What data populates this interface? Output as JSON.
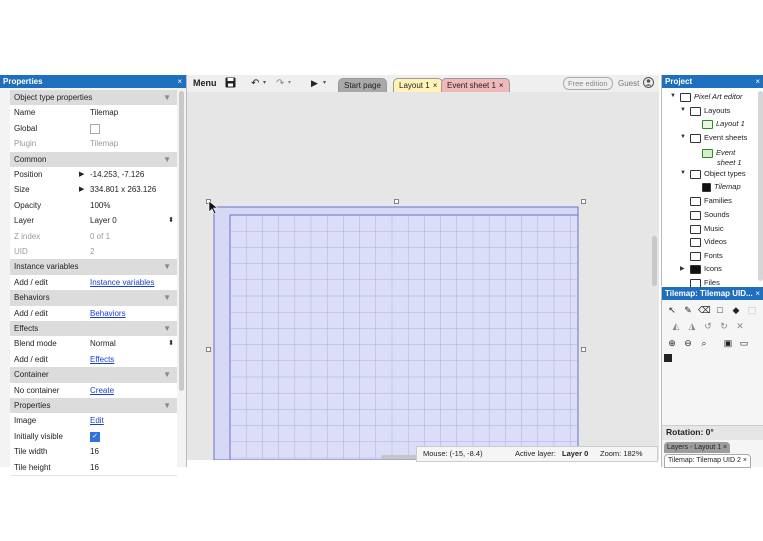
{
  "properties_panel": {
    "title": "Properties",
    "close": "×",
    "rows": [
      {
        "type": "section",
        "label": "Object type properties"
      },
      {
        "label": "Name",
        "value": "Tilemap"
      },
      {
        "label": "Global",
        "value": "",
        "kind": "checkbox",
        "checked": false
      },
      {
        "label": "Plugin",
        "value": "Tilemap",
        "disabled": true
      },
      {
        "type": "section",
        "label": "Common"
      },
      {
        "label": "Position",
        "value": "-14.253, -7.126",
        "expand": true
      },
      {
        "label": "Size",
        "value": "334.801 x 263.126",
        "expand": true
      },
      {
        "label": "Opacity",
        "value": "100%"
      },
      {
        "label": "Layer",
        "value": "Layer 0",
        "kind": "select"
      },
      {
        "label": "Z index",
        "value": "0 of 1",
        "disabled": true
      },
      {
        "label": "UID",
        "value": "2",
        "disabled": true
      },
      {
        "type": "section",
        "label": "Instance variables"
      },
      {
        "label": "Add / edit",
        "value": "Instance variables",
        "kind": "link"
      },
      {
        "type": "section",
        "label": "Behaviors"
      },
      {
        "label": "Add / edit",
        "value": "Behaviors",
        "kind": "link"
      },
      {
        "type": "section",
        "label": "Effects"
      },
      {
        "label": "Blend mode",
        "value": "Normal",
        "kind": "select"
      },
      {
        "label": "Add / edit",
        "value": "Effects",
        "kind": "link"
      },
      {
        "type": "section",
        "label": "Container"
      },
      {
        "label": "No container",
        "value": "Create",
        "kind": "link"
      },
      {
        "type": "section",
        "label": "Properties"
      },
      {
        "label": "Image",
        "value": "Edit",
        "kind": "link"
      },
      {
        "label": "Initially visible",
        "value": "",
        "kind": "checkbox",
        "checked": true
      },
      {
        "label": "Tile width",
        "value": "16"
      },
      {
        "label": "Tile height",
        "value": "16"
      }
    ]
  },
  "toolbar": {
    "menu_label": "Menu",
    "free_edition": "Free edition",
    "guest": "Guest"
  },
  "tabs": [
    {
      "label": "Start page",
      "bg": "#a9a9a9",
      "close": ""
    },
    {
      "label": "Layout 1",
      "bg": "#fff3b8",
      "close": "×"
    },
    {
      "label": "Event sheet 1",
      "bg": "#f0b8b8",
      "close": "×"
    }
  ],
  "status": {
    "mouse": "Mouse: (-15, -8.4)",
    "active_layer_label": "Active layer:",
    "active_layer_value": "Layer 0",
    "zoom": "Zoom: 182%"
  },
  "project_panel": {
    "title": "Project",
    "close": "×",
    "tree": [
      {
        "label": "Pixel Art editor",
        "italic": true,
        "icon": "folder",
        "twisty": "▼",
        "depth": 0
      },
      {
        "label": "Layouts",
        "icon": "folder",
        "twisty": "▼",
        "depth": 1
      },
      {
        "label": "Layout 1",
        "italic": true,
        "icon": "layout",
        "depth": 2
      },
      {
        "label": "Event sheets",
        "icon": "folder",
        "twisty": "▼",
        "depth": 1
      },
      {
        "label": "Event",
        "label2": "sheet 1",
        "italic": true,
        "icon": "eventsheet",
        "depth": 2
      },
      {
        "label": "Object types",
        "icon": "folder",
        "twisty": "▼",
        "depth": 1
      },
      {
        "label": "Tilemap",
        "italic": true,
        "icon": "tilemap",
        "depth": 2
      },
      {
        "label": "Families",
        "icon": "folder",
        "depth": 1
      },
      {
        "label": "Sounds",
        "icon": "folder",
        "depth": 1
      },
      {
        "label": "Music",
        "icon": "folder",
        "depth": 1
      },
      {
        "label": "Videos",
        "icon": "folder",
        "depth": 1
      },
      {
        "label": "Fonts",
        "icon": "folder",
        "depth": 1
      },
      {
        "label": "Icons",
        "icon": "folder-filled",
        "twisty": "▶",
        "depth": 1
      },
      {
        "label": "Files",
        "icon": "folder",
        "depth": 1
      }
    ]
  },
  "tilemap_panel": {
    "title": "Tilemap: Tilemap UID...",
    "close": "×",
    "rotation": "Rotation: 0°",
    "tab_layers": "Layers - Layout 1",
    "tab_layers_close": "×",
    "tab_tilemap": "Tilemap: Tilemap UID 2",
    "tab_tilemap_close": "×"
  },
  "colors": {
    "accent": "#1f6fbf",
    "tilemap_fill": "#d6d8f6",
    "tilemap_border": "#6b6fc8",
    "grid_line": "#a9acec"
  }
}
